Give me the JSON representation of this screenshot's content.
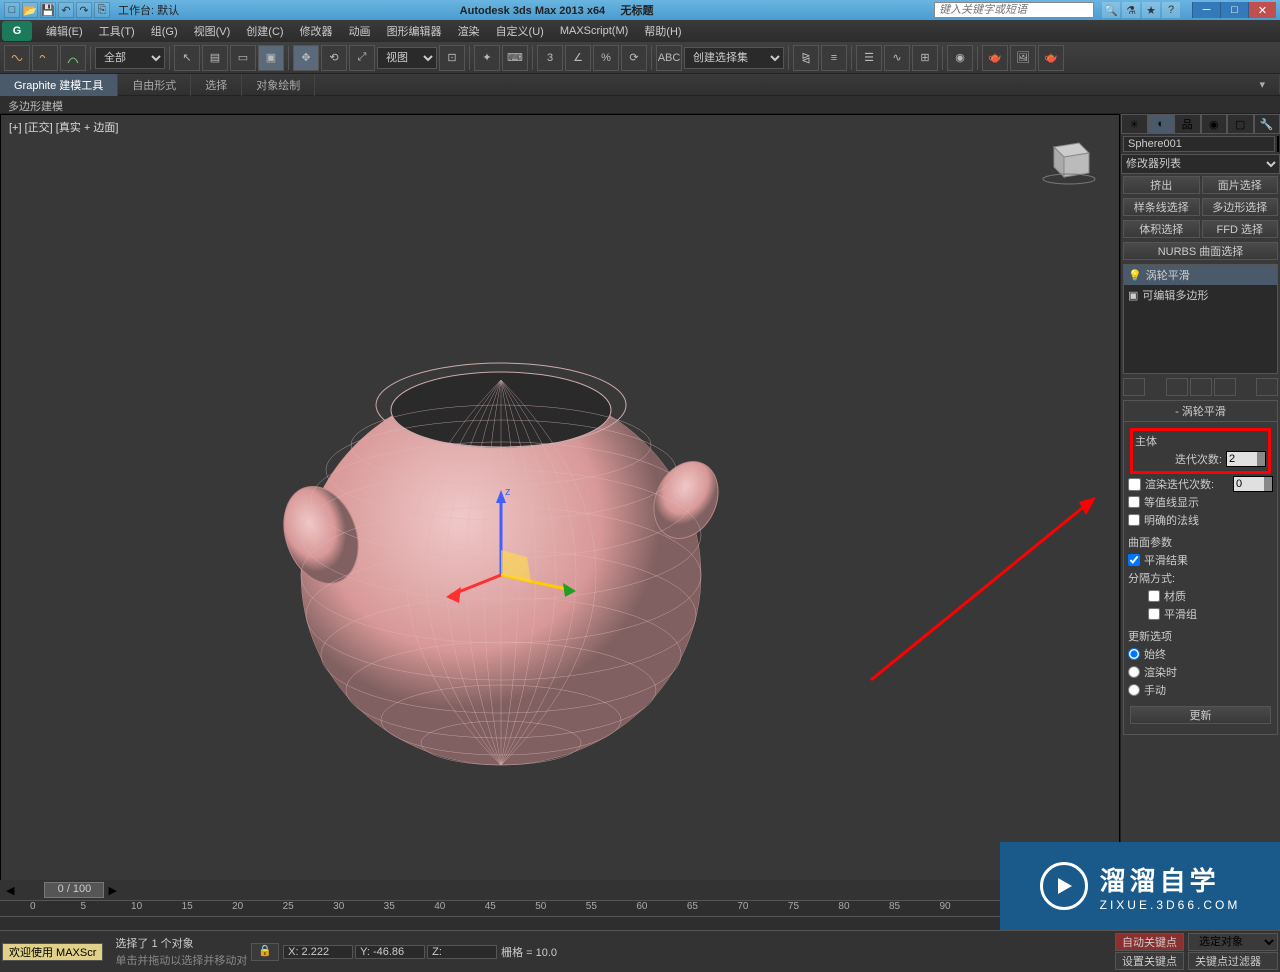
{
  "titlebar": {
    "workspace_label": "工作台: 默认",
    "app_title": "Autodesk 3ds Max  2013 x64",
    "doc_title": "无标题",
    "search_placeholder": "键入关键字或短语"
  },
  "menu": [
    "编辑(E)",
    "工具(T)",
    "组(G)",
    "视图(V)",
    "创建(C)",
    "修改器",
    "动画",
    "图形编辑器",
    "渲染",
    "自定义(U)",
    "MAXScript(M)",
    "帮助(H)"
  ],
  "ribbon": {
    "tabs": [
      "Graphite 建模工具",
      "自由形式",
      "选择",
      "对象绘制"
    ],
    "sub": "多边形建模"
  },
  "toolbar": {
    "filter_all": "全部",
    "view_dropdown": "视图",
    "named_sel": "创建选择集"
  },
  "viewport": {
    "label": "[+] [正交] [真实 + 边面]"
  },
  "cmdpanel": {
    "object_name": "Sphere001",
    "modifier_list": "修改器列表",
    "sel_buttons": [
      [
        "挤出",
        "面片选择"
      ],
      [
        "样条线选择",
        "多边形选择"
      ],
      [
        "体积选择",
        "FFD 选择"
      ]
    ],
    "nurbs_btn": "NURBS 曲面选择",
    "stack": [
      "涡轮平滑",
      "可编辑多边形"
    ],
    "rollout_title": "涡轮平滑",
    "section_main": "主体",
    "iterations_label": "迭代次数:",
    "iterations_value": "2",
    "render_iter_label": "渲染迭代次数:",
    "render_iter_value": "0",
    "isoline": "等值线显示",
    "explicit_normals": "明确的法线",
    "surface_params": "曲面参数",
    "smooth_result": "平滑结果",
    "separate_by": "分隔方式:",
    "material": "材质",
    "smooth_group": "平滑组",
    "update_options": "更新选项",
    "always": "始终",
    "render_time": "渲染时",
    "manual": "手动",
    "update_btn": "更新"
  },
  "timeslider": {
    "label": "0 / 100"
  },
  "trackbar": {
    "ticks": [
      0,
      5,
      10,
      15,
      20,
      25,
      30,
      35,
      40,
      45,
      50,
      55,
      60,
      65,
      70,
      75,
      80,
      85,
      90
    ]
  },
  "statusbar": {
    "welcome": "欢迎使用 MAXScr",
    "selected": "选择了 1 个对象",
    "prompt": "单击并拖动以选择并移动对",
    "x": "X: 2.222",
    "y": "Y: -46.86",
    "z": "Z:",
    "grid": "栅格 = 10.0",
    "autokey": "自动关键点",
    "selected_obj": "选定对象",
    "setkey": "设置关键点",
    "keyfilter": "关键点过滤器"
  },
  "watermark": {
    "big": "溜溜自学",
    "small": "ZIXUE.3D66.COM"
  }
}
